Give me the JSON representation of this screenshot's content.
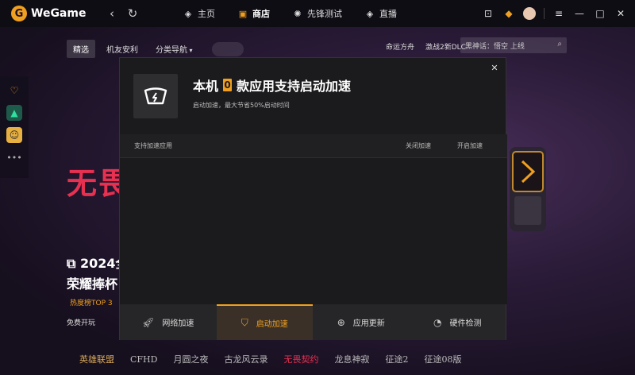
{
  "app": {
    "name": "WeGame"
  },
  "topnav": [
    {
      "label": "主页",
      "icon": "home-icon"
    },
    {
      "label": "商店",
      "icon": "store-icon",
      "active": true
    },
    {
      "label": "先锋测试",
      "icon": "pioneer-icon"
    },
    {
      "label": "直播",
      "icon": "live-icon"
    }
  ],
  "subnav": {
    "items": [
      "精选",
      "机友安利",
      "分类导航"
    ],
    "right": [
      "命运方舟",
      "激战2新DLC"
    ],
    "search_placeholder": "黑神话：悟空 上线"
  },
  "hero": {
    "title": "无畏",
    "news_title_1": "2024全",
    "news_title_2": "荣耀捧杯",
    "hot_tag": "热度榜TOP 3",
    "free_tag": "免费开玩"
  },
  "gamestrip": [
    "英雄联盟",
    "CFHD",
    "月圆之夜",
    "古龙风云录",
    "无畏契约",
    "龙息神寂",
    "征途2",
    "征途08版"
  ],
  "modal": {
    "title_prefix": "本机",
    "count": "0",
    "title_suffix": "款应用支持启动加速",
    "description": "启动加速，最大节省50%启动时间",
    "columns": {
      "app": "支持加速应用",
      "off": "关闭加速",
      "on": "开启加速"
    },
    "tabs": [
      {
        "label": "网络加速",
        "icon": "rocket-icon"
      },
      {
        "label": "启动加速",
        "icon": "speed-icon",
        "active": true
      },
      {
        "label": "应用更新",
        "icon": "update-icon"
      },
      {
        "label": "硬件检测",
        "icon": "hardware-check-icon"
      }
    ]
  },
  "colors": {
    "accent": "#f0a020",
    "brand_red": "#e83050",
    "modal_bg": "#1b1b1d"
  }
}
